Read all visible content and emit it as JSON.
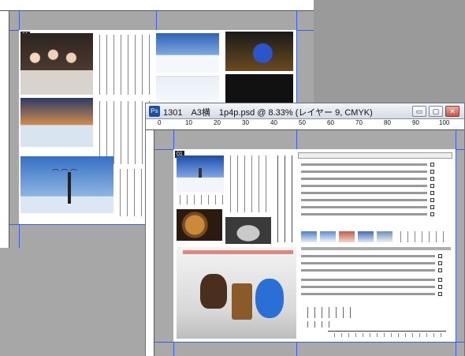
{
  "back_window": {
    "page_number": "01"
  },
  "front_window": {
    "title": "1301　A3横　1p4p.psd @ 8.33% (レイヤー 9, CMYK)",
    "app_icon": "Ps",
    "page_number": "01",
    "buttons": {
      "minimize": "▭",
      "maximize": "▢",
      "close": "✕"
    },
    "ruler_marks": [
      "0",
      "10",
      "20",
      "30",
      "40",
      "50",
      "60",
      "70",
      "80",
      "90",
      "100"
    ],
    "icon": "photoshop-icon"
  },
  "colors": {
    "guide": "#3a5fd8",
    "pasteboard": "#a9a9a9",
    "titlebar": "#d5dbe4"
  }
}
